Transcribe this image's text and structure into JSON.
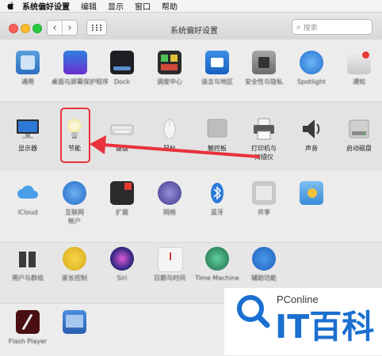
{
  "menubar": {
    "items": [
      "系统偏好设置",
      "编辑",
      "显示",
      "窗口",
      "帮助"
    ]
  },
  "window": {
    "title": "系统偏好设置",
    "search_placeholder": "搜索"
  },
  "rows": {
    "row1": [
      {
        "icon": "general-icon",
        "label": "通用"
      },
      {
        "icon": "desktop-icon",
        "label": "桌面与屏幕保护程序"
      },
      {
        "icon": "dock-icon",
        "label": "Dock"
      },
      {
        "icon": "mission-control-icon",
        "label": "调度中心"
      },
      {
        "icon": "language-region-icon",
        "label": "语言与地区"
      },
      {
        "icon": "security-icon",
        "label": "安全性与隐私"
      },
      {
        "icon": "spotlight-icon",
        "label": "Spotlight"
      },
      {
        "icon": "notifications-icon",
        "label": "通知"
      }
    ],
    "row2": [
      {
        "icon": "display-icon",
        "label": "显示器"
      },
      {
        "icon": "energy-saver-icon",
        "label": "节能"
      },
      {
        "icon": "keyboard-icon",
        "label": "键盘"
      },
      {
        "icon": "mouse-icon",
        "label": "鼠标"
      },
      {
        "icon": "trackpad-icon",
        "label": "触控板"
      },
      {
        "icon": "printer-icon",
        "label": "打印机与\n扫描仪"
      },
      {
        "icon": "sound-icon",
        "label": "声音"
      },
      {
        "icon": "startup-disk-icon",
        "label": "启动磁盘"
      }
    ],
    "row3": [
      {
        "icon": "icloud-icon",
        "label": "iCloud"
      },
      {
        "icon": "internet-accounts-icon",
        "label": "互联网\n帐户"
      },
      {
        "icon": "extensions-icon",
        "label": "扩展"
      },
      {
        "icon": "network-icon",
        "label": "网络"
      },
      {
        "icon": "bluetooth-icon",
        "label": "蓝牙"
      },
      {
        "icon": "sharing-icon",
        "label": "共享"
      },
      {
        "icon": "sharing-folder-icon",
        "label": ""
      }
    ],
    "row4": [
      {
        "icon": "users-groups-icon",
        "label": "用户与群组"
      },
      {
        "icon": "parental-controls-icon",
        "label": "家长控制"
      },
      {
        "icon": "siri-icon",
        "label": "Siri"
      },
      {
        "icon": "date-time-icon",
        "label": "日期与时间"
      },
      {
        "icon": "time-machine-icon",
        "label": "Time Machine"
      },
      {
        "icon": "accessibility-icon",
        "label": "辅助功能"
      }
    ],
    "row5": [
      {
        "icon": "flash-player-icon",
        "label": "Flash Player"
      },
      {
        "icon": "app-extra-icon",
        "label": ""
      }
    ]
  },
  "watermark": {
    "brand_small": "PConline",
    "brand_big": "IT百科"
  },
  "colors": {
    "highlight": "#e8323c",
    "watermark_blue": "#1a6fd0"
  }
}
